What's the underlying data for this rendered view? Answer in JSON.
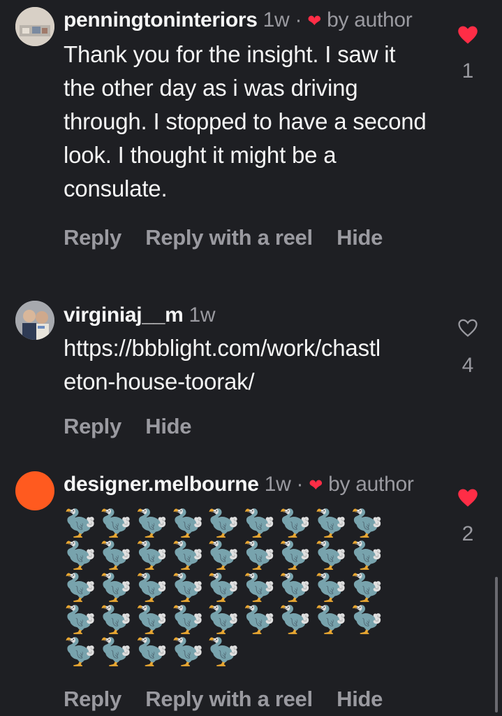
{
  "comments": [
    {
      "username": "penningtoninteriors",
      "time": "1w",
      "sep": "·",
      "liked_by_author": "by author",
      "text": "Thank you for the insight. I saw it the other day as i was driving through. I stopped to have a second look. I thought it might be a consulate.",
      "actions": [
        "Reply",
        "Reply with a reel",
        "Hide"
      ],
      "likes": "1",
      "liked": true,
      "avatar_color": "#cfc7bd"
    },
    {
      "username": "virginiaj__m",
      "time": "1w",
      "text": "https://bbblight.com/work/chastleton-house-toorak/",
      "actions": [
        "Reply",
        "Hide"
      ],
      "likes": "4",
      "liked": false,
      "avatar_color": "#8b8f98"
    },
    {
      "username": "designer.melbourne",
      "time": "1w",
      "sep": "·",
      "liked_by_author": "by author",
      "text": "🦤🦤🦤🦤🦤🦤🦤🦤🦤🦤🦤🦤🦤🦤🦤🦤🦤🦤🦤🦤🦤🦤🦤🦤🦤🦤🦤🦤🦤🦤🦤🦤🦤🦤🦤🦤🦤🦤🦤🦤🦤",
      "actions": [
        "Reply",
        "Reply with a reel",
        "Hide"
      ],
      "likes": "2",
      "liked": true,
      "avatar_color": "#ff5a1f"
    }
  ],
  "colors": {
    "heart": "#ff2d46",
    "muted": "#9a9aa0",
    "background": "#1e1f23"
  },
  "icons": {
    "liked": "heart-filled-icon",
    "unliked": "heart-outline-icon",
    "author_like": "small-heart-icon"
  }
}
